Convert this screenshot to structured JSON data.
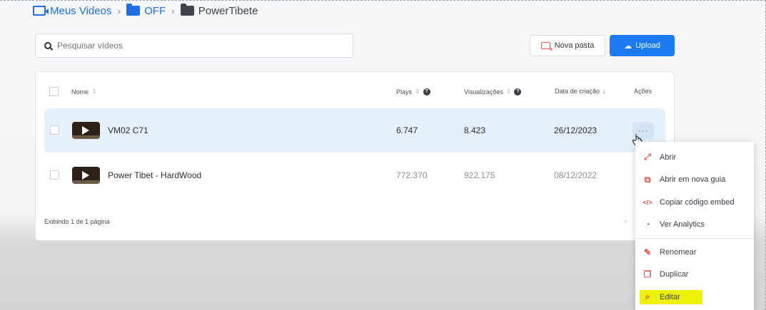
{
  "breadcrumb": {
    "root": "Meus Videos",
    "folder1": "OFF",
    "folder2": "PowerTibete",
    "separator": "›"
  },
  "search": {
    "placeholder": "Pesquisar vídeos",
    "value": ""
  },
  "actions": {
    "new_folder": "Nova pasta",
    "upload": "Upload"
  },
  "table": {
    "headers": {
      "name": "Nome",
      "plays": "Plays",
      "views": "Visualizações",
      "created": "Data de criação",
      "actions": "Ações"
    },
    "rows": [
      {
        "name": "VM02 C71",
        "plays": "6.747",
        "views": "8.423",
        "created": "26/12/2023"
      },
      {
        "name": "Power Tibet - HardWood",
        "plays": "772.370",
        "views": "922.175",
        "created": "08/12/2022"
      }
    ],
    "footer": "Exibindo 1 de 1 página",
    "more_icon": "···",
    "pager_arrow": "‹"
  },
  "menu": {
    "items": [
      {
        "label": "Abrir",
        "icon": "expand-icon",
        "glyph": "⤢"
      },
      {
        "label": "Abrir em nova guia",
        "icon": "external-link-icon",
        "glyph": "⧉"
      },
      {
        "label": "Copiar código embed",
        "icon": "code-icon",
        "glyph": "</>"
      },
      {
        "label": "Ver Analytics",
        "icon": "analytics-icon",
        "glyph": "◔"
      },
      {
        "label": "Renomear",
        "icon": "pencil-icon",
        "glyph": "✎"
      },
      {
        "label": "Duplicar",
        "icon": "duplicate-icon",
        "glyph": "❐"
      },
      {
        "label": "Editar",
        "icon": "edit-icon",
        "glyph": "⌕"
      }
    ]
  },
  "colors": {
    "accent": "#1a7cf0",
    "menu_icon": "#e0584a",
    "highlight": "#eef20a",
    "row_hover": "#e6f1fc"
  }
}
